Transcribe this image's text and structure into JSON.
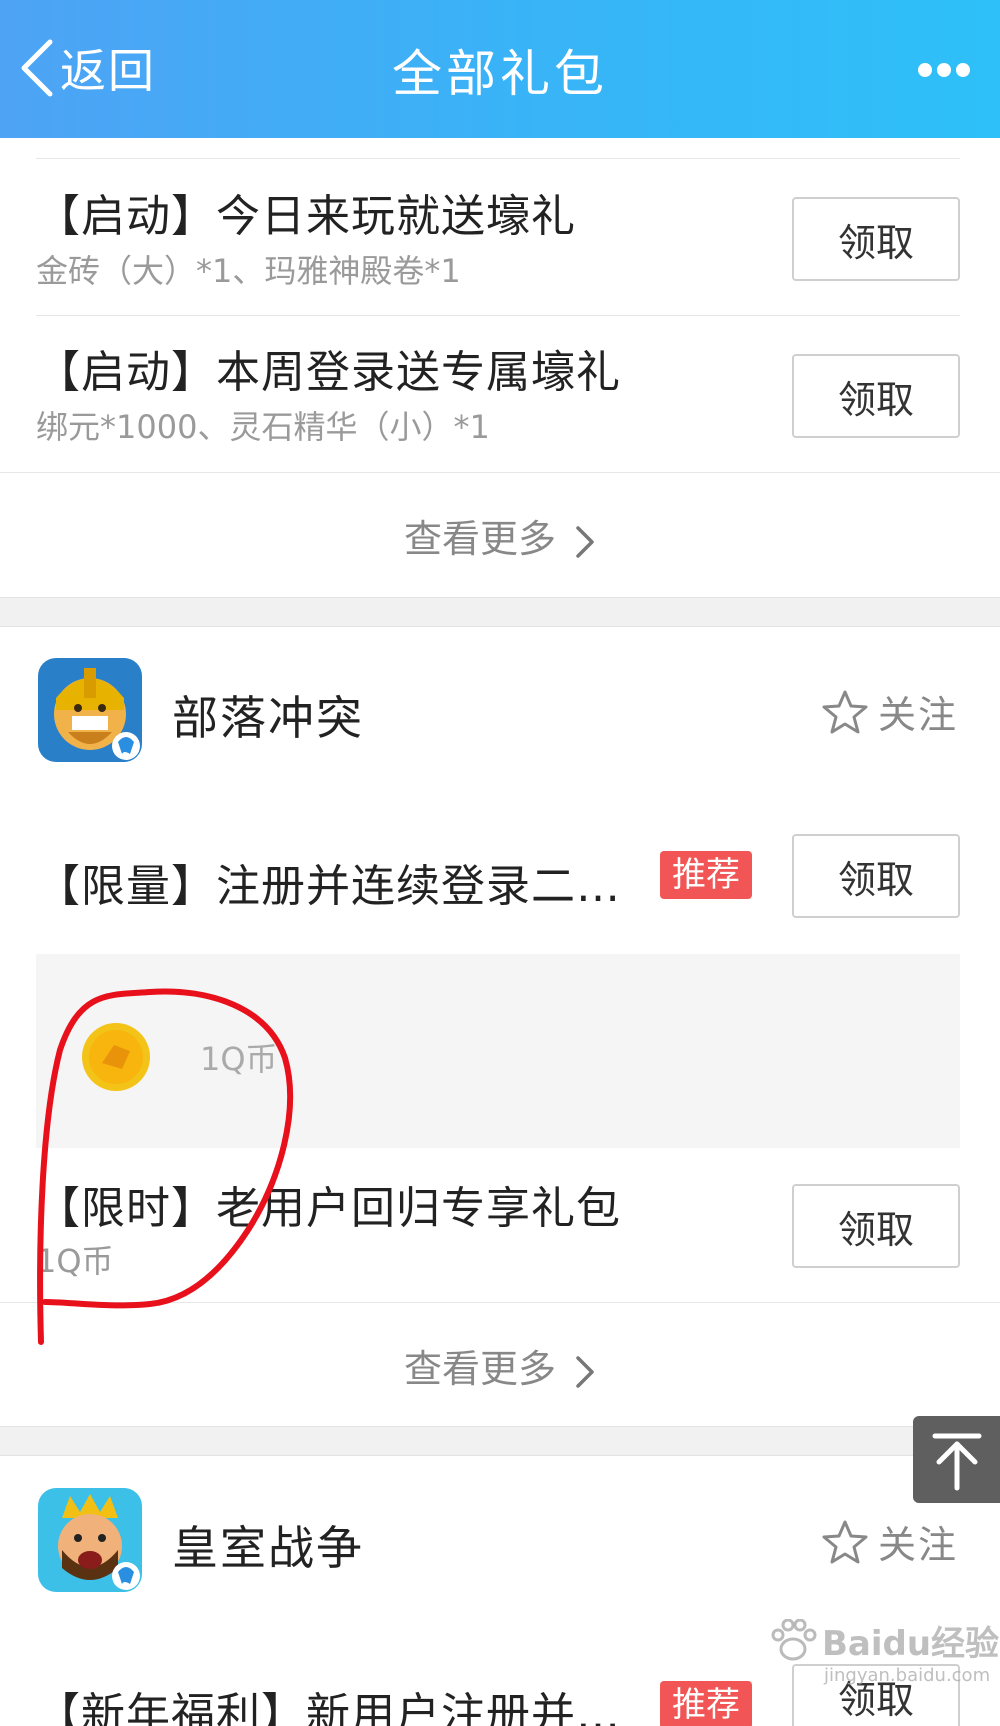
{
  "header": {
    "back_label": "返回",
    "title": "全部礼包"
  },
  "section1": {
    "gifts": [
      {
        "name": "【启动】今日来玩就送壕礼",
        "desc": "金砖（大）*1、玛雅神殿卷*1",
        "button": "领取"
      },
      {
        "name": "【启动】本周登录送专属壕礼",
        "desc": "绑元*1000、灵石精华（小）*1",
        "button": "领取"
      }
    ],
    "see_more": "查看更多"
  },
  "game2": {
    "title": "部落冲突",
    "follow_label": "关注",
    "gift1": {
      "name": "【限量】注册并连续登录二…",
      "badge": "推荐",
      "button": "领取"
    },
    "reward": {
      "label": "1Q币",
      "icon": "gold-coin-icon"
    },
    "gift2": {
      "name": "【限时】老用户回归专享礼包",
      "desc": "1Q币",
      "button": "领取"
    },
    "see_more": "查看更多"
  },
  "game3": {
    "title": "皇室战争",
    "follow_label": "关注",
    "gift1": {
      "name": "【新年福利】新用户注册并…",
      "badge": "推荐",
      "button": "领取"
    }
  },
  "watermark": {
    "text": "Baidu经验",
    "sub": "jingyan.baidu.com"
  },
  "colors": {
    "header_gradient_start": "#4ea3f5",
    "header_gradient_end": "#2ec0f8",
    "badge": "#f25555",
    "annotation": "#e8101a"
  }
}
